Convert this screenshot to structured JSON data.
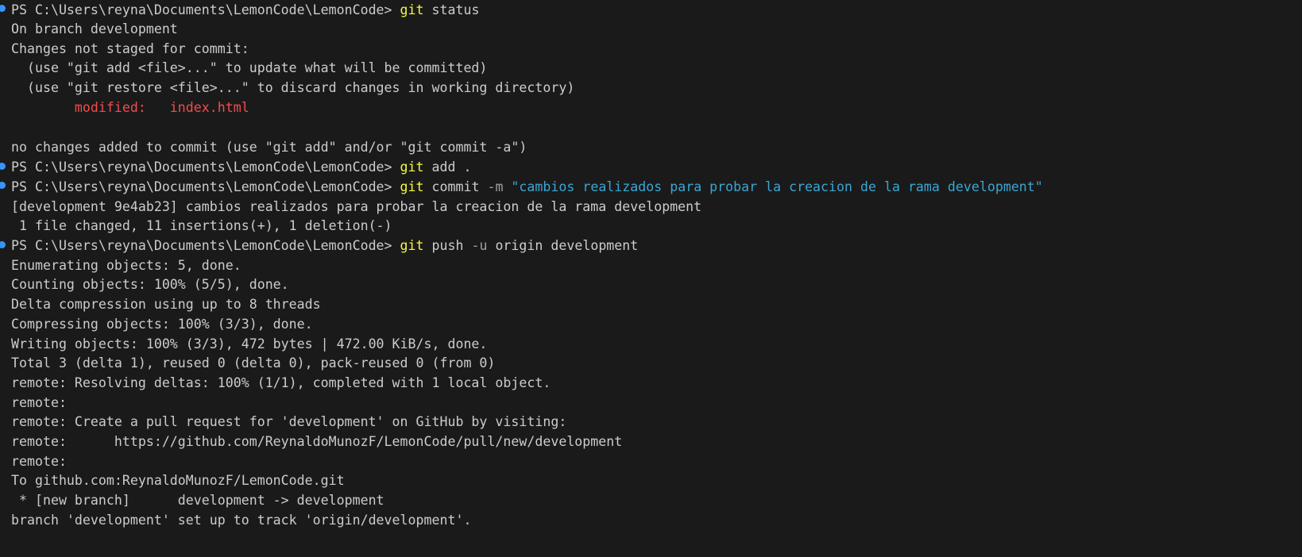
{
  "terminal": {
    "prompt": "PS C:\\Users\\reyna\\Documents\\LemonCode\\LemonCode> ",
    "cmd1": {
      "cmd": "git",
      "rest": " status"
    },
    "out1": [
      "On branch development",
      "Changes not staged for commit:",
      "  (use \"git add <file>...\" to update what will be committed)",
      "  (use \"git restore <file>...\" to discard changes in working directory)"
    ],
    "modified": {
      "label": "        modified:   index.html"
    },
    "out1b": "no changes added to commit (use \"git add\" and/or \"git commit -a\")",
    "cmd2": {
      "cmd": "git",
      "rest": " add ."
    },
    "cmd3": {
      "cmd": "git",
      "rest": " commit ",
      "flag": "-m",
      "str": " \"cambios realizados para probar la creacion de la rama development\""
    },
    "out3": [
      "[development 9e4ab23] cambios realizados para probar la creacion de la rama development",
      " 1 file changed, 11 insertions(+), 1 deletion(-)"
    ],
    "cmd4": {
      "cmd": "git",
      "rest1": " push ",
      "flag": "-u",
      "rest2": " origin development"
    },
    "out4": [
      "Enumerating objects: 5, done.",
      "Counting objects: 100% (5/5), done.",
      "Delta compression using up to 8 threads",
      "Compressing objects: 100% (3/3), done.",
      "Writing objects: 100% (3/3), 472 bytes | 472.00 KiB/s, done.",
      "Total 3 (delta 1), reused 0 (delta 0), pack-reused 0 (from 0)",
      "remote: Resolving deltas: 100% (1/1), completed with 1 local object.",
      "remote:",
      "remote: Create a pull request for 'development' on GitHub by visiting:",
      "remote:      https://github.com/ReynaldoMunozF/LemonCode/pull/new/development",
      "remote:",
      "To github.com:ReynaldoMunozF/LemonCode.git",
      " * [new branch]      development -> development",
      "branch 'development' set up to track 'origin/development'."
    ]
  },
  "colors": {
    "background": "#1a1a1a",
    "text": "#cccccc",
    "command": "#f5f543",
    "string": "#3aa6d4",
    "modified": "#f14c4c",
    "decoration_dot": "#3794ff"
  }
}
